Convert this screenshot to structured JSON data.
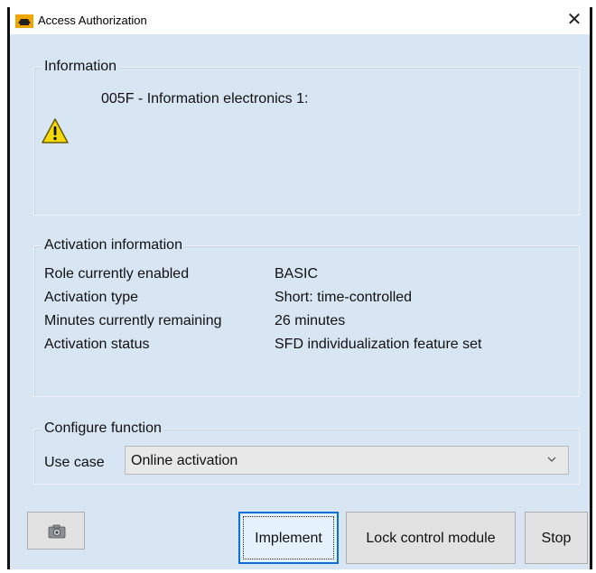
{
  "window": {
    "title": "Access Authorization",
    "close_label": "✕"
  },
  "information": {
    "group_label": "Information",
    "message": "005F - Information electronics 1:",
    "icon": "warning-icon"
  },
  "activation": {
    "group_label": "Activation information",
    "rows": [
      {
        "label": "Role currently enabled",
        "value": "BASIC"
      },
      {
        "label": "Activation type",
        "value": "Short: time-controlled"
      },
      {
        "label": "Minutes currently remaining",
        "value": "26 minutes"
      },
      {
        "label": "Activation status",
        "value": "SFD individualization feature set"
      }
    ]
  },
  "configure": {
    "group_label": "Configure function",
    "use_case_label": "Use case",
    "use_case_value": "Online activation"
  },
  "buttons": {
    "camera_icon": "camera-icon",
    "implement": "Implement",
    "lock": "Lock control module",
    "stop": "Stop"
  },
  "colors": {
    "window_bg": "#d8e5f3",
    "accent": "#0a6fd6",
    "warning": "#f5d90a"
  }
}
